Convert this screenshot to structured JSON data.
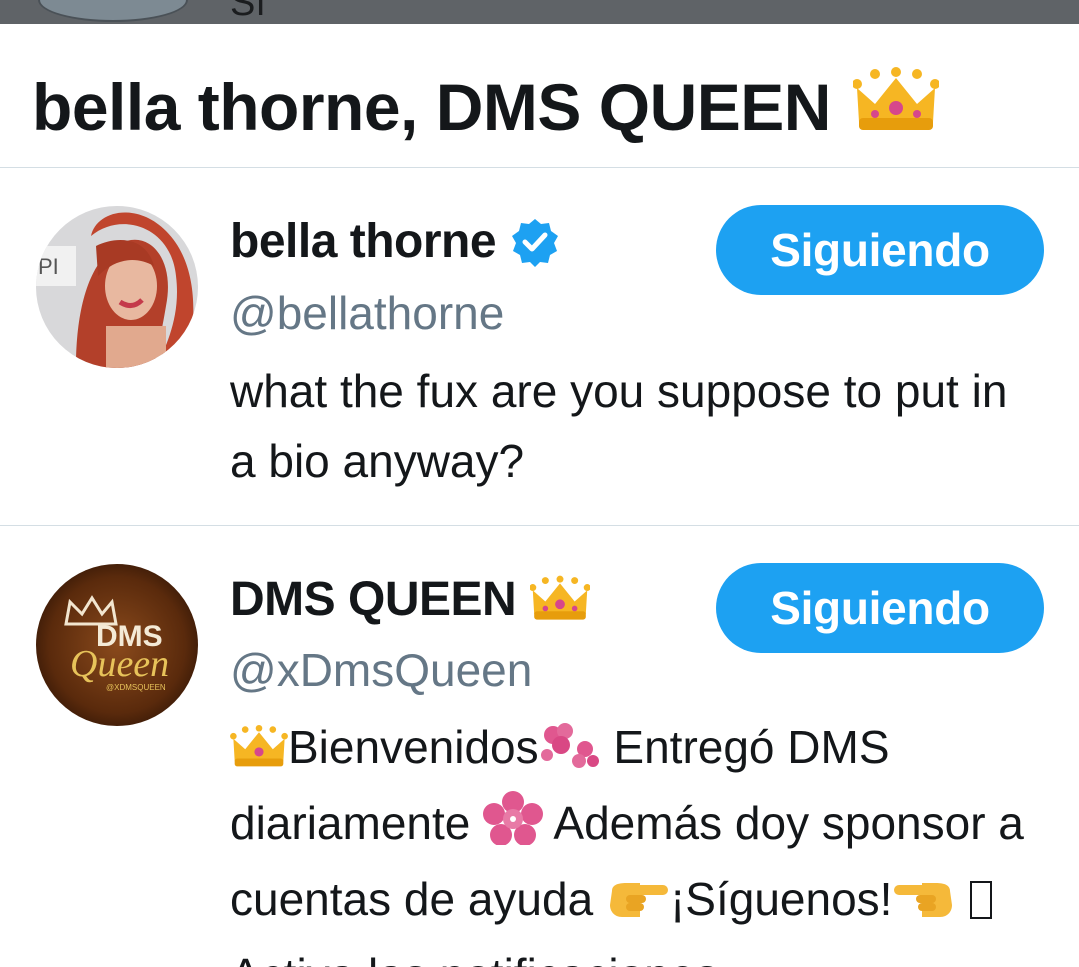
{
  "top_overlay": {
    "text": "Sí"
  },
  "header": {
    "title": "bella thorne, DMS QUEEN",
    "title_icon": "crown-emoji"
  },
  "users": [
    {
      "display_name": "bella thorne",
      "verified": true,
      "handle": "@bellathorne",
      "bio": "what the fux are you suppose to put in a bio anyway?",
      "follow_label": "Siguiendo",
      "avatar_icon": "profile-photo"
    },
    {
      "display_name": "DMS QUEEN",
      "name_icon": "crown-emoji",
      "handle": "@xDmsQueen",
      "bio_parts": {
        "p1": "Bienvenidos",
        "p2": " Entregó DMS diariamente ",
        "p3": " Además doy sponsor a cuentas de ayuda ",
        "p4": "¡Síguenos!",
        "p5": " Activa las notificaciones"
      },
      "follow_label": "Siguiendo",
      "avatar_text_top": "DMS",
      "avatar_text_script": "Queen",
      "avatar_text_small": "@XDMSQUEEN",
      "avatar_icon": "dms-queen-logo"
    }
  ],
  "colors": {
    "accent": "#1da1f2",
    "secondary_text": "#657786",
    "divider": "#d4dee4",
    "overlay": "#5f6367"
  }
}
